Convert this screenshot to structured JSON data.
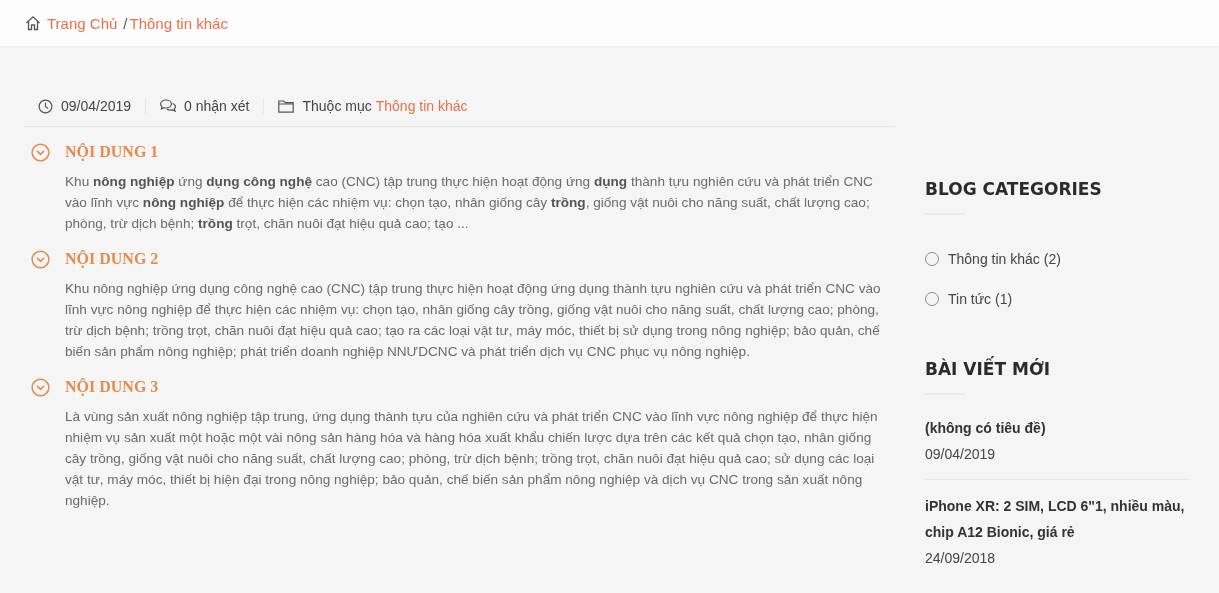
{
  "breadcrumb": {
    "home": "Trang Chủ",
    "separator": "/",
    "current": "Thông tin khác"
  },
  "meta": {
    "date": "09/04/2019",
    "comments": "0 nhận xét",
    "category_label": "Thuộc mục",
    "category": "Thông tin khác"
  },
  "sections": [
    {
      "title": "NỘI DUNG 1",
      "text": "Khu **nông nghiệp** ứng **dụng công nghệ** cao (CNC) tập trung thực hiện hoạt động ứng **dụng** thành tựu nghiên cứu và phát triển CNC vào lĩnh vực **nông nghiệp** để thực hiện các nhiệm vụ: chọn tạo, nhân giống cây **trồng**, giống vật nuôi cho năng suất, chất lượng cao; phòng, trừ dịch bệnh; **trồng** trọt, chăn nuôi đạt hiệu quả cao; tạo ..."
    },
    {
      "title": "NỘI DUNG 2",
      "text": "Khu nông nghiệp ứng dụng công nghệ cao (CNC) tập trung thực hiện hoạt động ứng dụng thành tựu nghiên cứu và phát triển CNC vào lĩnh vực nông nghiệp để  thực hiện các nhiệm vụ: chọn tạo, nhân giống cây trồng, giống vật nuôi cho năng suất, chất lượng cao; phòng, trừ dịch bệnh; trồng trọt, chăn nuôi đạt hiệu quả cao; tạo ra các loại vật tư, máy móc, thiết bị  sử dụng trong nông nghiệp; bảo quản, chế biến sản phẩm nông nghiệp; phát triển doanh nghiệp NNƯDCNC và phát triển dịch vụ CNC phục vụ nông nghiệp."
    },
    {
      "title": "NỘI DUNG 3",
      "text": "Là vùng sản xuất nông nghiệp tập trung, ứng dụng thành tựu của nghiên cứu và phát triển CNC vào lĩnh vực nông nghiệp để thực hiện nhiệm vụ sản xuất một hoặc một vài nông sản hàng hóa và hàng hóa xuất khẩu chiến lược dựa trên các kết quả chọn tạo, nhân giống cây trồng, giống vật nuôi cho năng suất, chất lượng cao; phòng, trừ dịch bệnh; trồng trọt, chăn nuôi đạt hiệu quả cao; sử dụng các loại vật tư, máy móc, thiết bị hiện đại trong nông nghiệp; bảo quản, chế biến sản phẩm nông nghiệp và dịch vụ CNC trong sản xuất nông nghiệp."
    }
  ],
  "sidebar": {
    "categories_title": "BLOG CATEGORIES",
    "categories": [
      {
        "label": "Thông tin khác (2)"
      },
      {
        "label": "Tin tức (1)"
      }
    ],
    "recent_title": "BÀI VIẾT MỚI",
    "recent_posts": [
      {
        "title": "(không có tiêu đề)",
        "date": "09/04/2019"
      },
      {
        "title": "iPhone XR: 2 SIM, LCD 6\"1, nhiều màu, chip A12 Bionic, giá rẻ",
        "date": "24/09/2018"
      }
    ]
  }
}
